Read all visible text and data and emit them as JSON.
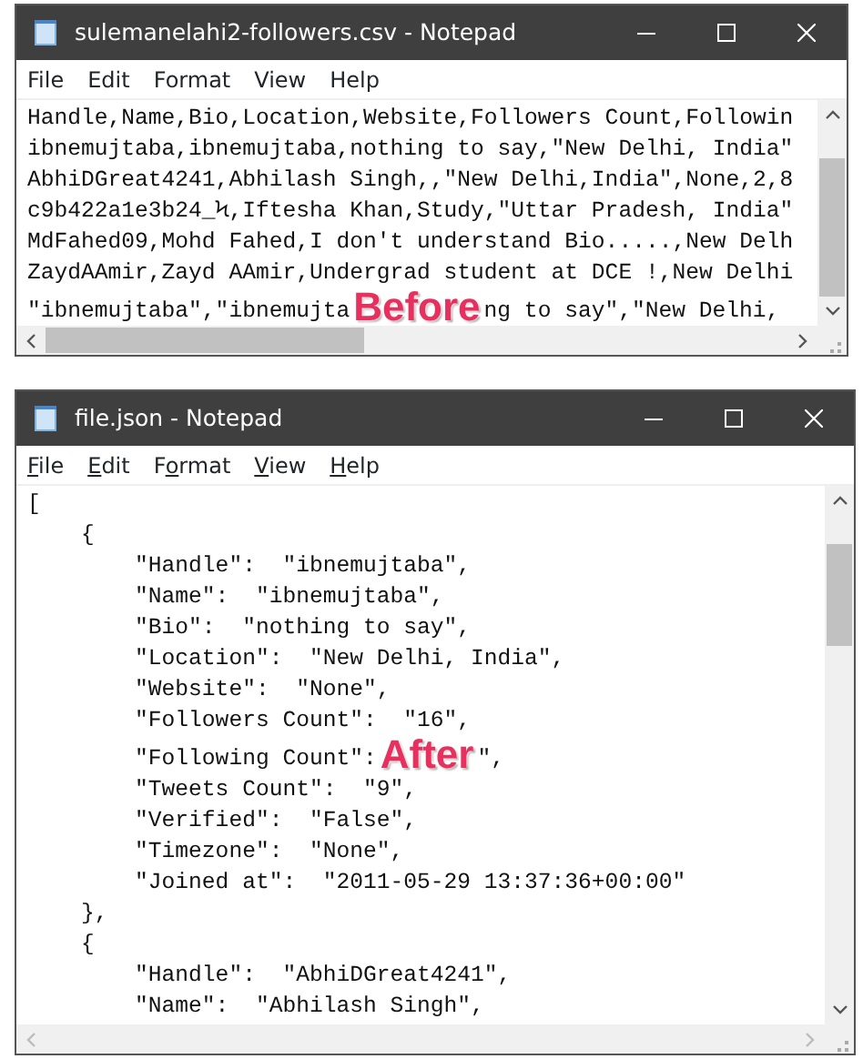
{
  "windows": [
    {
      "title": "sulemanelahi2-followers.csv - Notepad",
      "menu": [
        {
          "label": "File"
        },
        {
          "label": "Edit"
        },
        {
          "label": "Format"
        },
        {
          "label": "View"
        },
        {
          "label": "Help"
        }
      ],
      "annotation": "Before",
      "horizontal_scroll": true,
      "lines": [
        {
          "parts": [
            "Handle,Name,Bio,Location,Website,Followers Count,Followin"
          ]
        },
        {
          "parts": [
            "ibnemujtaba,ibnemujtaba,nothing to say,\"New Delhi, India\""
          ]
        },
        {
          "parts": [
            "AbhiDGreat4241,Abhilash Singh,,\"New Delhi,India\",None,2,8"
          ]
        },
        {
          "parts": [
            "c9b422a1e3b24_Ϟ,Iftesha Khan,Study,\"Uttar Pradesh, India\""
          ]
        },
        {
          "parts": [
            "MdFahed09,Mohd Fahed,I don't understand Bio.....,New Delh"
          ]
        },
        {
          "parts": [
            "ZaydAAmir,Zayd AAmir,Undergrad student at DCE !,New Delhi"
          ]
        },
        {
          "parts": [
            "\"ibnemujtaba\",\"ibnemujta",
            "ng to say\",\"New Delhi,"
          ]
        }
      ]
    },
    {
      "title": "file.json - Notepad",
      "menu": [
        {
          "access_key": "F",
          "rest": "ile"
        },
        {
          "access_key": "E",
          "rest": "dit"
        },
        {
          "lead": "F",
          "access_key": "o",
          "rest": "rmat"
        },
        {
          "access_key": "V",
          "rest": "iew"
        },
        {
          "access_key": "H",
          "rest": "elp"
        }
      ],
      "annotation": "After",
      "horizontal_scroll": false,
      "lines": [
        {
          "parts": [
            "["
          ]
        },
        {
          "parts": [
            "    {"
          ]
        },
        {
          "parts": [
            "        \"Handle\":  \"ibnemujtaba\","
          ]
        },
        {
          "parts": [
            "        \"Name\":  \"ibnemujtaba\","
          ]
        },
        {
          "parts": [
            "        \"Bio\":  \"nothing to say\","
          ]
        },
        {
          "parts": [
            "        \"Location\":  \"New Delhi, India\","
          ]
        },
        {
          "parts": [
            "        \"Website\":  \"None\","
          ]
        },
        {
          "parts": [
            "        \"Followers Count\":  \"16\","
          ]
        },
        {
          "parts": [
            "        \"Following Count\":",
            "\","
          ]
        },
        {
          "parts": [
            "        \"Tweets Count\":  \"9\","
          ]
        },
        {
          "parts": [
            "        \"Verified\":  \"False\","
          ]
        },
        {
          "parts": [
            "        \"Timezone\":  \"None\","
          ]
        },
        {
          "parts": [
            "        \"Joined at\":  \"2011-05-29 13:37:36+00:00\""
          ]
        },
        {
          "parts": [
            "    },"
          ]
        },
        {
          "parts": [
            "    {"
          ]
        },
        {
          "parts": [
            "        \"Handle\":  \"AbhiDGreat4241\","
          ]
        },
        {
          "parts": [
            "        \"Name\":  \"Abhilash Singh\","
          ]
        }
      ]
    }
  ]
}
